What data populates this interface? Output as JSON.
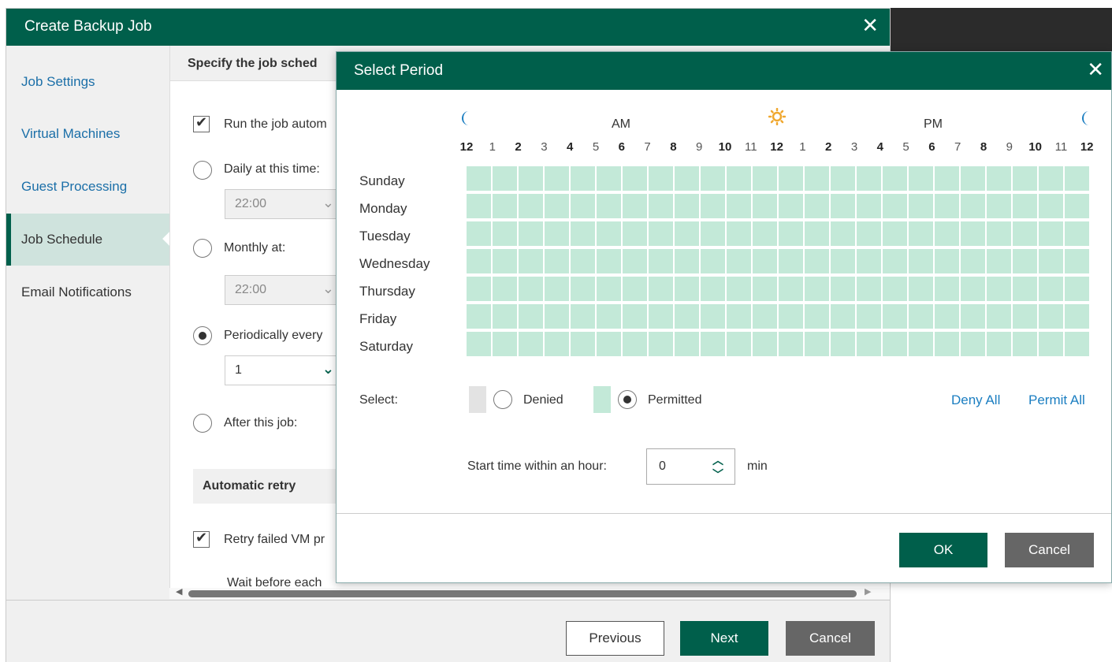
{
  "wizard": {
    "title": "Create Backup Job",
    "close_glyph": "✕",
    "sidebar": [
      {
        "label": "Job Settings"
      },
      {
        "label": "Virtual Machines"
      },
      {
        "label": "Guest Processing"
      },
      {
        "label": "Job Schedule",
        "active": true
      },
      {
        "label": "Email Notifications"
      }
    ],
    "content_header": "Specify the job sched",
    "run_auto": {
      "checked": true,
      "label": "Run the job autom"
    },
    "daily": {
      "label": "Daily at this time:",
      "time": "22:00"
    },
    "monthly": {
      "label": "Monthly at:",
      "time": "22:00"
    },
    "periodically": {
      "label": "Periodically every",
      "value": "1",
      "selected": true
    },
    "after_job": {
      "label": "After this job:"
    },
    "automatic_retry": {
      "header": "Automatic retry",
      "retry_label": "Retry failed VM pr",
      "wait_label": "Wait before each"
    },
    "footer": {
      "previous": "Previous",
      "next": "Next",
      "cancel": "Cancel"
    }
  },
  "dialog": {
    "title": "Select Period",
    "close_glyph": "✕",
    "am_label": "AM",
    "pm_label": "PM",
    "hours": [
      "12",
      "1",
      "2",
      "3",
      "4",
      "5",
      "6",
      "7",
      "8",
      "9",
      "10",
      "11",
      "12",
      "1",
      "2",
      "3",
      "4",
      "5",
      "6",
      "7",
      "8",
      "9",
      "10",
      "11",
      "12"
    ],
    "days": [
      "Sunday",
      "Monday",
      "Tuesday",
      "Wednesday",
      "Thursday",
      "Friday",
      "Saturday"
    ],
    "select_label": "Select:",
    "denied_label": "Denied",
    "permitted_label": "Permitted",
    "selected_mode": "Permitted",
    "deny_all": "Deny All",
    "permit_all": "Permit All",
    "start_time_label": "Start time within an hour:",
    "start_time_value": "0",
    "start_time_unit": "min",
    "ok": "OK",
    "cancel": "Cancel",
    "colors": {
      "permitted": "#c3e9d8",
      "denied": "#e3e3e3",
      "accent": "#005f4b",
      "link": "#1b7ec1",
      "sun": "#f0a830",
      "moon": "#1b7ec1"
    }
  }
}
